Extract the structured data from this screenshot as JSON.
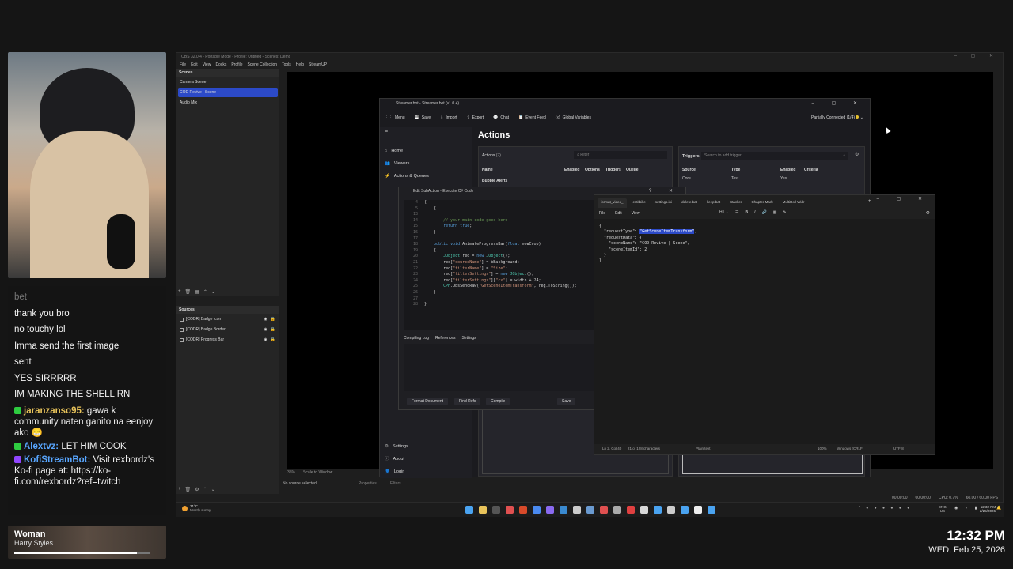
{
  "chat": {
    "faded_message": "bet",
    "messages": [
      {
        "text": "thank you bro"
      },
      {
        "text": "no touchy lol"
      },
      {
        "text": "Imma send the first image"
      },
      {
        "text": "sent"
      },
      {
        "text": "YES SIRRRRR"
      },
      {
        "text": "IM MAKING THE SHELL RN"
      }
    ],
    "user_messages": [
      {
        "user": "jaranzanso95:",
        "user_color": "#e8c35a",
        "text": "gawa k community naten ganito na eenjoy ako 😁"
      },
      {
        "user": "Alextvz:",
        "user_color": "#58a6ff",
        "text": "LET HIM COOK"
      },
      {
        "user": "KofiStreamBot:",
        "user_color": "#58a6ff",
        "text": "Visit rexbordz's Ko-fi page at: https://ko-fi.com/rexbordz?ref=twitch"
      }
    ]
  },
  "now_playing": {
    "title": "Woman",
    "artist": "Harry Styles",
    "progress": 0.9
  },
  "clock": {
    "time": "12:32 PM",
    "date": "WED, Feb 25, 2026"
  },
  "obs": {
    "title": "OBS 32.0.4 - Portable Mode - Profile: Untitled - Scenes: Demo",
    "menu": [
      "File",
      "Edit",
      "View",
      "Docks",
      "Profile",
      "Scene Collection",
      "Tools",
      "Help",
      "StreamUP"
    ],
    "scenes_header": "Scenes",
    "scenes": [
      {
        "label": "Camera Scene",
        "selected": false
      },
      {
        "label": "COD Revive | Scene",
        "selected": true
      },
      {
        "label": "Audio Mix",
        "selected": false
      }
    ],
    "sources_header": "Sources",
    "sources": [
      {
        "label": "[CODR] Badge Icon"
      },
      {
        "label": "[CODR] Badge Border"
      },
      {
        "label": "[CODR] Progress Bar"
      }
    ],
    "zoom": "35%",
    "scale_mode": "Scale to Window",
    "no_source": "No source selected",
    "properties": "Properties",
    "filters": "Filters",
    "stats": [
      {
        "label": "00:00:00"
      },
      {
        "label": "00:00:00"
      },
      {
        "label": "CPU: 0.7%"
      },
      {
        "label": "60.00 / 60.00 FPS"
      }
    ]
  },
  "streamerbot": {
    "title": "Streamer.bot - Streamer.bot (v1.0.4)",
    "toolbar": [
      "Menu",
      "Save",
      "Import",
      "Export",
      "Chat",
      "Event Feed",
      "Global Variables"
    ],
    "status": "Partially Connected (1/4)",
    "nav": [
      "Home",
      "Viewers",
      "Actions & Queues"
    ],
    "nav_bottom": [
      "Settings",
      "About",
      "Login"
    ],
    "page_title": "Actions",
    "actions_label": "Actions",
    "actions_count": "(7)",
    "filter_placeholder": "Filter",
    "columns": [
      "Name",
      "Enabled",
      "Options",
      "Triggers",
      "Queue"
    ],
    "group": "Bubble Alerts",
    "triggers_title": "Triggers",
    "trigger_search": "Search to add trigger...",
    "trigger_columns": [
      "Source",
      "Type",
      "Enabled",
      "Criteria"
    ],
    "trigger_row": [
      "Core",
      "Test",
      "Yes",
      ""
    ]
  },
  "editor": {
    "title": "Edit SubAction - Execute C# Code",
    "code_lines": [
      {
        "num": "4",
        "code": "{"
      },
      {
        "num": "5",
        "code": "    {"
      },
      {
        "num": "13",
        "code": ""
      },
      {
        "num": "14",
        "code": "        // your main code goes here"
      },
      {
        "num": "15",
        "code": "        return true;"
      },
      {
        "num": "16",
        "code": "    }"
      },
      {
        "num": "17",
        "code": ""
      },
      {
        "num": "18",
        "code": "    public void AnimateProgressBar(float newCrop)"
      },
      {
        "num": "19",
        "code": "    {"
      },
      {
        "num": "20",
        "code": "        JObject req = new JObject();"
      },
      {
        "num": "21",
        "code": "        req[\"sourceName\"] = bBackground;"
      },
      {
        "num": "22",
        "code": "        req[\"filterName\"] = \"Size\";"
      },
      {
        "num": "23",
        "code": "        req[\"filterSettings\"] = new JObject();"
      },
      {
        "num": "24",
        "code": "        req[\"filterSettings\"][\"cx\"] = width + 24;"
      },
      {
        "num": "25",
        "code": "        CPH.ObsSendRaw(\"GetSceneItemTransform\", req.ToString());"
      },
      {
        "num": "26",
        "code": "    }"
      },
      {
        "num": "27",
        "code": ""
      },
      {
        "num": "28",
        "code": "}"
      }
    ],
    "tabs": [
      "Compiling Log",
      "References",
      "Settings"
    ],
    "buttons": [
      "Format Document",
      "Find Refs",
      "Compile",
      "Save"
    ]
  },
  "notepad": {
    "tabs": [
      "format_video_",
      "ectifbille",
      "settings.ini",
      "delete.bat",
      "keep.bat",
      "Stacker",
      "Chapter Mark",
      "MultiRoll Widr"
    ],
    "menu": [
      "File",
      "Edit",
      "View"
    ],
    "json_lines": [
      {
        "text": "{"
      },
      {
        "text": "  \"requestType\": \"GetSceneItemTransform\","
      },
      {
        "text": "  \"requestData\": {"
      },
      {
        "text": "    \"sceneName\": \"COD Revive | Scene\","
      },
      {
        "text": "    \"sceneItemId\": 2"
      },
      {
        "text": "  }"
      },
      {
        "text": "}"
      }
    ],
    "status": [
      "Ln 2, Col 40",
      "21 of 128 characters",
      "Plain text",
      "100%",
      "Windows (CRLF)",
      "UTF-8"
    ]
  },
  "taskbar": {
    "weather_temp": "31°C",
    "weather_desc": "Mostly sunny",
    "lang": "ENG",
    "region": "US",
    "time": "12:32 PM",
    "date": "2/25/2026"
  }
}
